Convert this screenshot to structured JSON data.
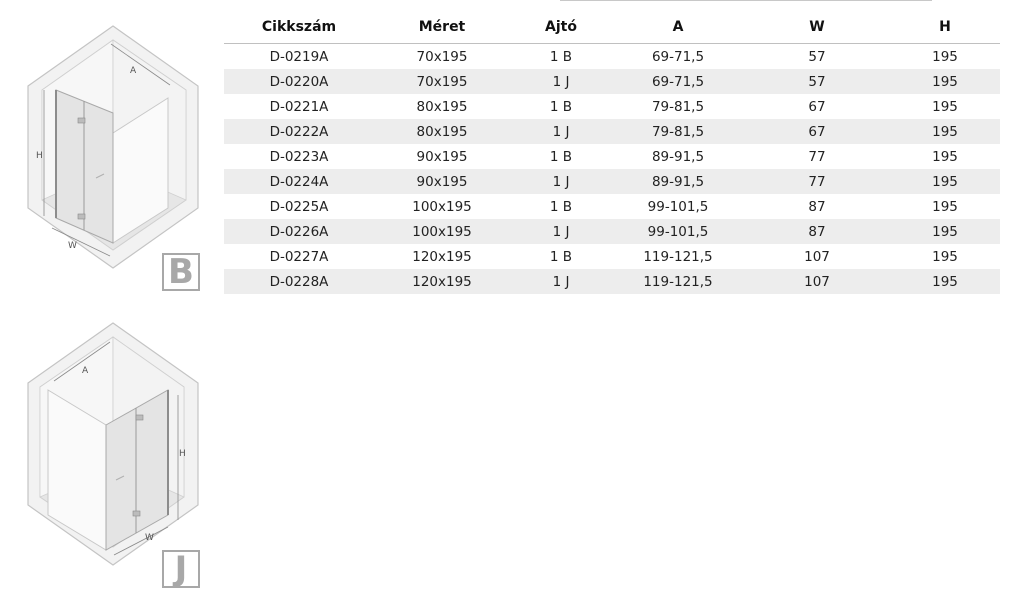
{
  "table": {
    "headers": [
      "Cikkszám",
      "Méret",
      "Ajtó",
      "A",
      "W",
      "H"
    ],
    "rows": [
      [
        "D-0219A",
        "70x195",
        "1 B",
        "69-71,5",
        "57",
        "195"
      ],
      [
        "D-0220A",
        "70x195",
        "1 J",
        "69-71,5",
        "57",
        "195"
      ],
      [
        "D-0221A",
        "80x195",
        "1 B",
        "79-81,5",
        "67",
        "195"
      ],
      [
        "D-0222A",
        "80x195",
        "1 J",
        "79-81,5",
        "67",
        "195"
      ],
      [
        "D-0223A",
        "90x195",
        "1 B",
        "89-91,5",
        "77",
        "195"
      ],
      [
        "D-0224A",
        "90x195",
        "1 J",
        "89-91,5",
        "77",
        "195"
      ],
      [
        "D-0225A",
        "100x195",
        "1 B",
        "99-101,5",
        "87",
        "195"
      ],
      [
        "D-0226A",
        "100x195",
        "1 J",
        "99-101,5",
        "87",
        "195"
      ],
      [
        "D-0227A",
        "120x195",
        "1 B",
        "119-121,5",
        "107",
        "195"
      ],
      [
        "D-0228A",
        "120x195",
        "1 J",
        "119-121,5",
        "107",
        "195"
      ]
    ]
  },
  "diagrams": {
    "b": {
      "badge": "B",
      "label_a": "A",
      "label_h": "H",
      "label_w": "W"
    },
    "j": {
      "badge": "J",
      "label_a": "A",
      "label_h": "H",
      "label_w": "W"
    }
  },
  "colors": {
    "wall": "#f0f0f0",
    "wall_edge": "#c4c4c4",
    "floor": "#e2e2e2",
    "glass": "#dcdcdc",
    "row_stripe": "#ededed"
  }
}
